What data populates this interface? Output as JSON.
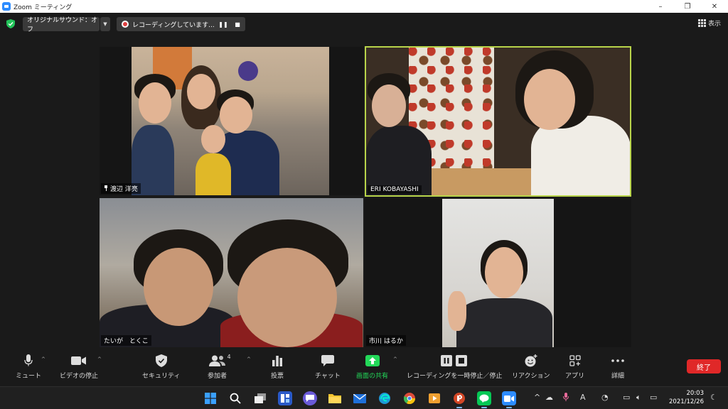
{
  "window": {
    "title": "Zoom ミーティング",
    "minimize": "–",
    "maximize": "❐",
    "close": "✕"
  },
  "topbar": {
    "sound_label": "オリジナルサウンド：オフ",
    "recording_label": "レコーディングしています...",
    "view_label": "表示"
  },
  "tiles": [
    {
      "name": "渡辺 洋亮",
      "pinned": true
    },
    {
      "name": "ERI KOBAYASHI",
      "active_speaker": true
    },
    {
      "name": "たいが　とくこ"
    },
    {
      "name": "市川 はるか"
    }
  ],
  "toolbar": {
    "mute": "ミュート",
    "stop_video": "ビデオの停止",
    "security": "セキュリティ",
    "participants": "参加者",
    "participants_count": "4",
    "polls": "投票",
    "chat": "チャット",
    "share": "画面の共有",
    "record_pause": "レコーディングを一時停止／停止",
    "reactions": "リアクション",
    "apps": "アプリ",
    "more": "詳細",
    "end": "終了"
  },
  "taskbar": {
    "time": "20:03",
    "date": "2021/12/26"
  },
  "colors": {
    "active_speaker_border": "#b8d44a",
    "share_green": "#23d959",
    "end_red": "#e02828",
    "zoom_blue": "#2d8cff"
  }
}
